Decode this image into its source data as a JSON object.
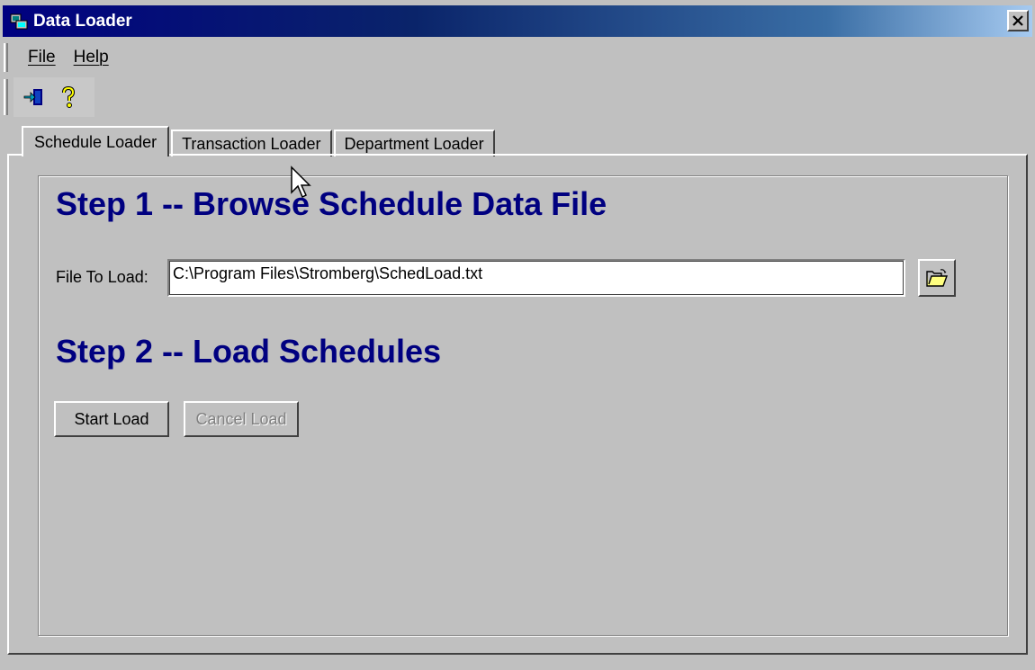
{
  "window": {
    "title": "Data Loader"
  },
  "menu": {
    "items": [
      {
        "label": "File"
      },
      {
        "label": "Help"
      }
    ]
  },
  "toolbar": {
    "buttons": [
      {
        "icon": "exit-icon"
      },
      {
        "icon": "help-icon"
      }
    ]
  },
  "tabs": [
    {
      "label": "Schedule Loader",
      "active": true
    },
    {
      "label": "Transaction Loader",
      "active": false
    },
    {
      "label": "Department Loader",
      "active": false
    }
  ],
  "main": {
    "step1_heading": "Step 1 -- Browse Schedule Data File",
    "file_label": "File To Load:",
    "file_value": "C:\\Program Files\\Stromberg\\SchedLoad.txt",
    "browse_icon": "open-folder-icon",
    "step2_heading": "Step 2 -- Load Schedules",
    "start_button": "Start Load",
    "cancel_button": "Cancel Load"
  },
  "colors": {
    "heading": "#000080",
    "titlebar": "#000080",
    "face": "#c0c0c0"
  }
}
